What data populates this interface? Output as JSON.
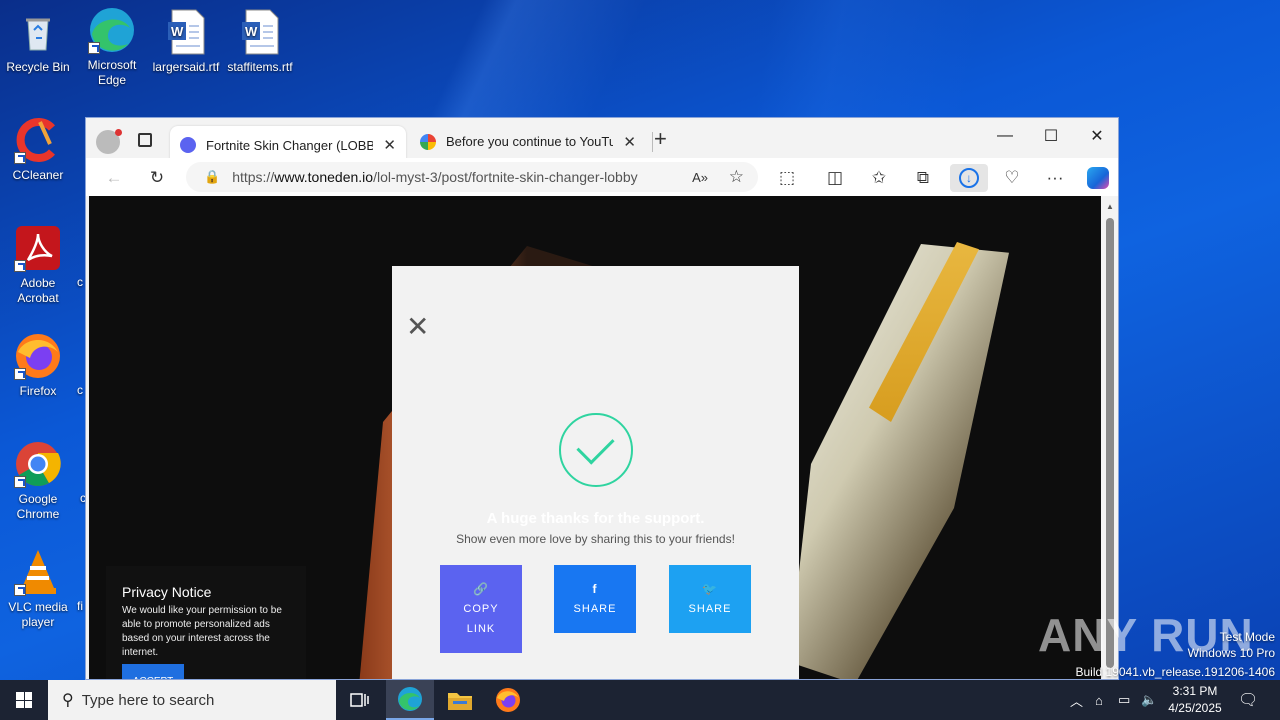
{
  "desktop": {
    "icons": [
      {
        "label": "Recycle Bin"
      },
      {
        "label": "Microsoft Edge"
      },
      {
        "label": "largersaid.rtf"
      },
      {
        "label": "staffitems.rtf"
      },
      {
        "label": "CCleaner"
      },
      {
        "label": "Adobe Acrobat"
      },
      {
        "label": "Firefox"
      },
      {
        "label": "Google Chrome"
      },
      {
        "label": "VLC media player"
      }
    ],
    "cut_labels": [
      "c",
      "c",
      "c",
      "fi"
    ]
  },
  "browser": {
    "tabs": [
      {
        "title": "Fortnite Skin Changer (LOBBY) by",
        "close": "✕"
      },
      {
        "title": "Before you continue to YouTube",
        "close": "✕"
      }
    ],
    "new_tab": "+",
    "url_prefix": "https://",
    "url_host": "www.toneden.io",
    "url_path": "/lol-myst-3/post/fortnite-skin-changer-lobby",
    "window_controls": {
      "minimize": "—",
      "maximize": "☐",
      "close": "✕"
    }
  },
  "modal": {
    "close": "✕",
    "thanks": "A huge thanks for the support.",
    "subtitle": "Show even more love by sharing this to your friends!",
    "buttons": [
      {
        "icon": "🔗",
        "label": "COPY LINK",
        "color": "#5b63f0"
      },
      {
        "icon": "f",
        "label": "SHARE",
        "color": "#1877f2"
      },
      {
        "icon": "🐦",
        "label": "SHARE",
        "color": "#1da1f2"
      }
    ]
  },
  "privacy": {
    "title": "Privacy Notice",
    "text": "We would like your permission to be able to promote personalized ads based on your interest across the internet.",
    "accept": "ACCEPT"
  },
  "watermark": {
    "logo": "ANY RUN",
    "lines": [
      "Test Mode",
      "Windows 10 Pro",
      "Build 19041.vb_release.191206-1406"
    ]
  },
  "taskbar": {
    "search_placeholder": "Type here to search",
    "time": "3:31 PM",
    "date": "4/25/2025"
  }
}
